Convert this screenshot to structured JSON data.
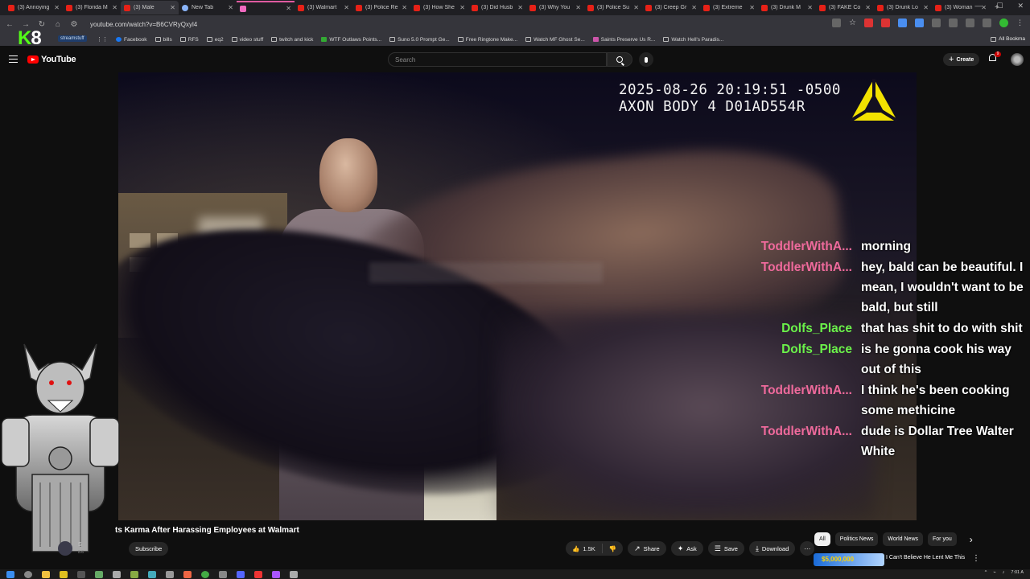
{
  "browser": {
    "tabs": [
      {
        "title": "(3) Annoying",
        "fav": "yt"
      },
      {
        "title": "(3) Florida M",
        "fav": "yt"
      },
      {
        "title": "(3) Male",
        "fav": "yt",
        "active": true
      },
      {
        "title": "New Tab",
        "fav": "chrome"
      },
      {
        "title": "",
        "fav": "pink"
      },
      {
        "title": "(3) Walmart",
        "fav": "yt"
      },
      {
        "title": "(3) Police Re",
        "fav": "yt"
      },
      {
        "title": "(3) How She",
        "fav": "yt"
      },
      {
        "title": "(3) Did Husb",
        "fav": "yt"
      },
      {
        "title": "(3) Why You",
        "fav": "yt"
      },
      {
        "title": "(3) Police Su",
        "fav": "yt"
      },
      {
        "title": "(3) Creep Gr",
        "fav": "yt"
      },
      {
        "title": "(3) Extreme",
        "fav": "yt"
      },
      {
        "title": "(3) Drunk M",
        "fav": "yt"
      },
      {
        "title": "(3) FAKE Co",
        "fav": "yt"
      },
      {
        "title": "(3) Drunk Lo",
        "fav": "yt"
      },
      {
        "title": "(3) Woman",
        "fav": "yt"
      }
    ],
    "url": "youtube.com/watch?v=B6CVRyQxyl4",
    "bookmarks": [
      {
        "label": "Facebook",
        "icon": "fb"
      },
      {
        "label": "bills",
        "icon": "folder"
      },
      {
        "label": "RFS",
        "icon": "folder"
      },
      {
        "label": "eq2",
        "icon": "folder"
      },
      {
        "label": "video stuff",
        "icon": "folder"
      },
      {
        "label": "twitch and kick",
        "icon": "folder"
      },
      {
        "label": "WTF Outlaws Points...",
        "icon": "gr"
      },
      {
        "label": "Suno 5.0 Prompt Ge...",
        "icon": "folder"
      },
      {
        "label": "Free Ringtone Make...",
        "icon": "folder"
      },
      {
        "label": "Watch MF Ghost Se...",
        "icon": "folder"
      },
      {
        "label": "Saints Preserve Us R...",
        "icon": "pk"
      },
      {
        "label": "Watch Hell's Paradis...",
        "icon": "folder"
      }
    ],
    "all_bookmarks": "All Bookma",
    "streamstuff": "streamstuff",
    "k8_k": "K",
    "k8_num": "8"
  },
  "youtube": {
    "logo": "YouTube",
    "search_placeholder": "Search",
    "create": "Create",
    "notif_count": "9"
  },
  "video": {
    "timestamp_line1": "2025-08-26 20:19:51 -0500",
    "timestamp_line2": "AXON BODY 4 D01AD554R",
    "title": "ts Karma After Harassing Employees at Walmart",
    "channel": "S",
    "subs": "8.6"
  },
  "chat": [
    {
      "user": "ToddlerWithA...",
      "color": "#ef6a9c",
      "text": "morning"
    },
    {
      "user": "ToddlerWithA...",
      "color": "#ef6a9c",
      "text": "hey, bald can be beautiful. I mean, I wouldn't want to be bald, but still"
    },
    {
      "user": "Dolfs_Place",
      "color": "#6bf24a",
      "text": "that has shit to do with shit"
    },
    {
      "user": "Dolfs_Place",
      "color": "#6bf24a",
      "text": "is he gonna cook his way out of this"
    },
    {
      "user": "ToddlerWithA...",
      "color": "#ef6a9c",
      "text": "I think he's been cooking some methicine"
    },
    {
      "user": "ToddlerWithA...",
      "color": "#ef6a9c",
      "text": "dude is Dollar Tree Walter White"
    }
  ],
  "actions": {
    "subscribe": "Subscribe",
    "likes": "1.5K",
    "share": "Share",
    "ask": "Ask",
    "save": "Save",
    "download": "Download"
  },
  "chips": [
    "All",
    "Politics News",
    "World News",
    "For you"
  ],
  "recommended": {
    "thumb_text": "$5,000,000",
    "title": "I Can't Believe He Lent Me This"
  },
  "taskbar": {
    "time": "7:01 A"
  }
}
